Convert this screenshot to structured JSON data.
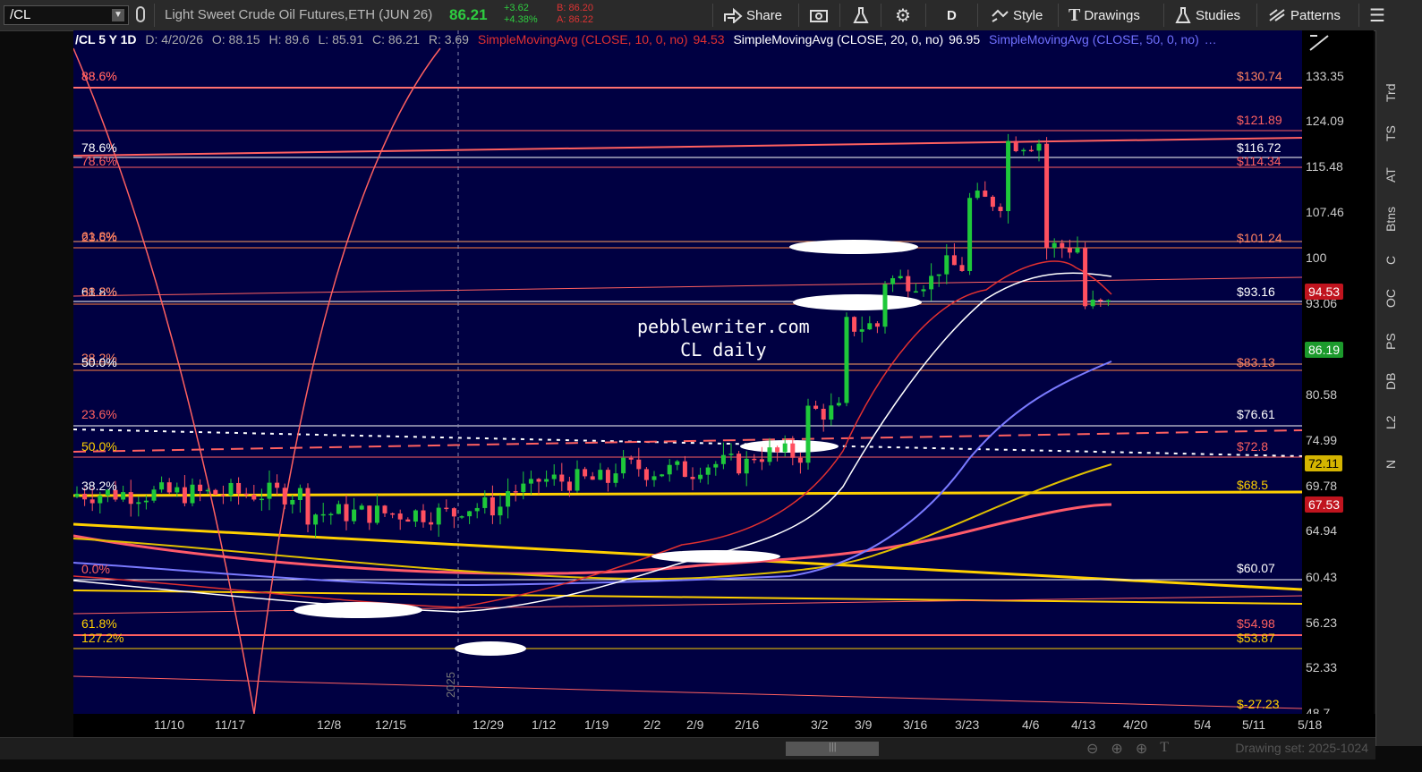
{
  "toolbar": {
    "symbol": "/CL",
    "instrument_name": "Light Sweet Crude Oil Futures,ETH (JUN 26)",
    "last_price": "86.21",
    "change": "+3.62",
    "change_pct": "+4.38%",
    "bid": "B: 86.20",
    "ask": "A: 86.22",
    "share_label": "Share",
    "period_label": "D",
    "style_label": "Style",
    "drawings_label": "Drawings",
    "studies_label": "Studies",
    "patterns_label": "Patterns",
    "colors": {
      "bid_ask": "#d33",
      "change": "#2ecc40",
      "last": "#2ecc40"
    }
  },
  "legend": {
    "header": "/CL 5 Y 1D",
    "date": "D: 4/20/26",
    "open": "O: 88.15",
    "high": "H: 89.6",
    "low": "L: 85.91",
    "close": "C: 86.21",
    "range": "R: 3.69",
    "sma10": {
      "text": "SimpleMovingAvg (CLOSE, 10, 0, no)",
      "value": "94.53",
      "color": "#e03030"
    },
    "sma20": {
      "text": "SimpleMovingAvg (CLOSE, 20, 0, no)",
      "value": "96.95",
      "color": "#ffffff"
    },
    "sma50": {
      "text": "SimpleMovingAvg (CLOSE, 50, 0, no)",
      "value": "…",
      "color": "#7070ff"
    }
  },
  "watermark": {
    "line1": "pebblewriter.com",
    "line2": "CL daily"
  },
  "price_axis": {
    "ticks": [
      "133.35",
      "124.09",
      "115.48",
      "107.46",
      "100",
      "93.06",
      "86.19",
      "80.58",
      "74.99",
      "69.78",
      "64.94",
      "60.43",
      "56.23",
      "52.33",
      "48.7"
    ],
    "tags": [
      {
        "text": "94.53",
        "color": "#c0141e"
      },
      {
        "text": "86.19",
        "color": "#1c9a2c"
      },
      {
        "text": "72.11",
        "color": "#d4b400"
      },
      {
        "text": "67.53",
        "color": "#c0141e"
      }
    ]
  },
  "time_axis": {
    "ticks": [
      "11/10",
      "11/17",
      "12/8",
      "12/15",
      "12/29",
      "1/12",
      "1/19",
      "2/2",
      "2/9",
      "2/16",
      "3/2",
      "3/9",
      "3/16",
      "3/23",
      "4/6",
      "4/13",
      "4/20",
      "5/4",
      "5/11",
      "5/18"
    ],
    "year_marker": "2025"
  },
  "fib_labels": [
    {
      "text": "88.6%",
      "color": "#ff6060"
    },
    {
      "text": "88.6%",
      "color": "#ff6060"
    },
    {
      "text": "78.6%",
      "color": "#ffffff"
    },
    {
      "text": "78.6%",
      "color": "#ff6060"
    },
    {
      "text": "61.8%",
      "color": "#ff8060"
    },
    {
      "text": "23.6%",
      "color": "#ff8060"
    },
    {
      "text": "61.8%",
      "color": "#ffffff"
    },
    {
      "text": "38.2%",
      "color": "#ff8060"
    },
    {
      "text": "38.2%",
      "color": "#ff8060"
    },
    {
      "text": "50.0%",
      "color": "#ffffff"
    },
    {
      "text": "23.6%",
      "color": "#ff6060"
    },
    {
      "text": "50.0%",
      "color": "#ffd000"
    },
    {
      "text": "38.2%",
      "color": "#ffffff"
    },
    {
      "text": "0.0%",
      "color": "#ff6060"
    },
    {
      "text": "61.8%",
      "color": "#ffd000"
    },
    {
      "text": "127.2%",
      "color": "#ffd000"
    }
  ],
  "level_labels": [
    {
      "text": "$130.74",
      "color": "#ff8060"
    },
    {
      "text": "$121.89",
      "color": "#ff6060"
    },
    {
      "text": "$116.72",
      "color": "#ffffff"
    },
    {
      "text": "$114.34",
      "color": "#ff6060"
    },
    {
      "text": "$101.24",
      "color": "#ff8060"
    },
    {
      "text": "$93.16",
      "color": "#ffffff"
    },
    {
      "text": "$83.13",
      "color": "#ff8060"
    },
    {
      "text": "$76.61",
      "color": "#ffffff"
    },
    {
      "text": "$72.8",
      "color": "#ff6060"
    },
    {
      "text": "$68.5",
      "color": "#ffd000"
    },
    {
      "text": "$60.07",
      "color": "#ffffff"
    },
    {
      "text": "$54.98",
      "color": "#ff6060"
    },
    {
      "text": "$53.87",
      "color": "#ffd000"
    },
    {
      "text": "$-27.23",
      "color": "#ffd000"
    }
  ],
  "right_tabs": [
    "Trd",
    "TS",
    "AT",
    "Btns",
    "C",
    "OC",
    "PS",
    "DB",
    "L2",
    "N"
  ],
  "status": {
    "drawing_set": "Drawing set: 2025-1024"
  }
}
